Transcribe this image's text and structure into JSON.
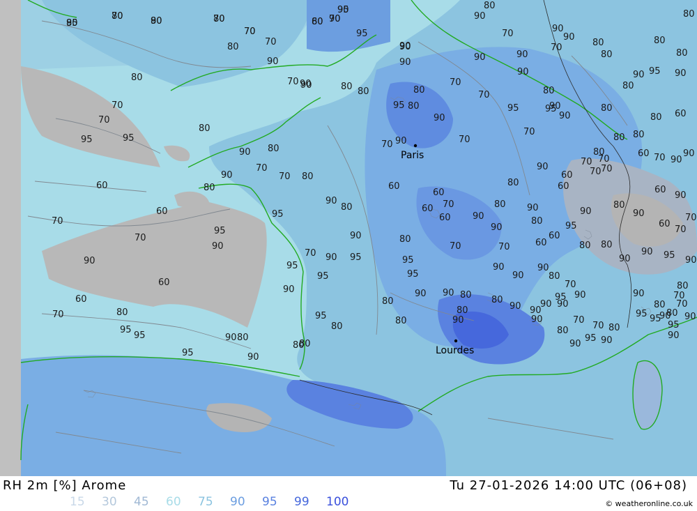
{
  "footer": {
    "title": "RH 2m [%] Arome",
    "datetime": "Tu 27-01-2026 14:00 UTC (06+08)",
    "credit": "© weatheronline.co.uk"
  },
  "legend": [
    {
      "label": "15",
      "color": "#c8d8e8"
    },
    {
      "label": "30",
      "color": "#b4c8dc"
    },
    {
      "label": "45",
      "color": "#a0b8d4"
    },
    {
      "label": "60",
      "color": "#a8dce8"
    },
    {
      "label": "75",
      "color": "#8cc4e0"
    },
    {
      "label": "90",
      "color": "#6c9ee0"
    },
    {
      "label": "95",
      "color": "#5a82e0"
    },
    {
      "label": "99",
      "color": "#4668dc"
    },
    {
      "label": "100",
      "color": "#3a50dc"
    }
  ],
  "map": {
    "cities": [
      {
        "name": "Paris"
      },
      {
        "name": "Lourdes"
      }
    ],
    "contour_labels": [
      "80",
      "80",
      "80",
      "80",
      "70",
      "80",
      "90",
      "95",
      "90",
      "90",
      "80",
      "80",
      "95",
      "90",
      "80",
      "70",
      "90",
      "70",
      "80",
      "80",
      "90",
      "80",
      "80",
      "90",
      "70",
      "90",
      "90",
      "90",
      "80",
      "90",
      "80",
      "95",
      "90",
      "70",
      "80",
      "80",
      "90",
      "80",
      "90",
      "90",
      "80",
      "95",
      "70",
      "70",
      "80",
      "95",
      "95",
      "90",
      "90",
      "80",
      "80",
      "60",
      "70",
      "70",
      "95",
      "95",
      "80",
      "90",
      "80",
      "70",
      "70",
      "80",
      "90",
      "90",
      "70",
      "70",
      "70",
      "90",
      "80",
      "80",
      "80",
      "70",
      "70",
      "60",
      "70",
      "90",
      "90",
      "80",
      "60",
      "60",
      "70",
      "70",
      "95",
      "90",
      "90",
      "60",
      "60",
      "70",
      "80",
      "95",
      "95",
      "95",
      "90",
      "80",
      "60",
      "60",
      "70",
      "60",
      "60",
      "80",
      "80",
      "90",
      "90",
      "70",
      "90",
      "60",
      "60",
      "70",
      "70",
      "80",
      "90",
      "90",
      "60",
      "60",
      "70",
      "70",
      "90",
      "95",
      "90",
      "80",
      "60",
      "60",
      "80",
      "80",
      "90",
      "90",
      "95",
      "90",
      "80",
      "70",
      "80",
      "95",
      "90",
      "90",
      "80",
      "70",
      "95",
      "95",
      "90",
      "90",
      "90",
      "80",
      "70",
      "95",
      "90",
      "90",
      "90",
      "90",
      "70",
      "90",
      "95",
      "95",
      "95",
      "90",
      "80",
      "90",
      "80",
      "80",
      "90",
      "90",
      "80",
      "70",
      "70",
      "95",
      "90",
      "90",
      "80",
      "90",
      "80",
      "70",
      "90",
      "95",
      "95",
      "90",
      "80",
      "90",
      "80",
      "80",
      "95",
      "90",
      "80",
      "80",
      "80",
      "90",
      "90",
      "95",
      "95",
      "70",
      "90",
      "70",
      "70",
      "60",
      "70",
      "90"
    ]
  }
}
